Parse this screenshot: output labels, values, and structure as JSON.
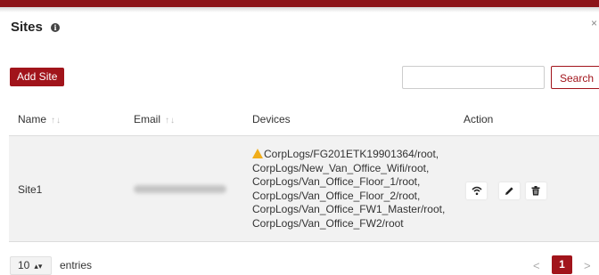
{
  "dialog": {
    "title": "Sites",
    "info_icon": "info-icon",
    "close_icon": "×"
  },
  "toolbar": {
    "add_label": "Add Site",
    "search_value": "",
    "search_placeholder": "",
    "search_label": "Search"
  },
  "table": {
    "columns": {
      "name": "Name",
      "email": "Email",
      "devices": "Devices",
      "action": "Action"
    },
    "sort_glyph": "↑↓",
    "rows": [
      {
        "name": "Site1",
        "email": "",
        "devices": [
          "CorpLogs/FG201ETK19901364/root,",
          "CorpLogs/New_Van_Office_Wifi/root,",
          "CorpLogs/Van_Office_Floor_1/root,",
          "CorpLogs/Van_Office_Floor_2/root,",
          "CorpLogs/Van_Office_FW1_Master/root,",
          "CorpLogs/Van_Office_FW2/root"
        ],
        "first_device_warning": true,
        "actions": [
          "wifi-icon",
          "pencil-icon",
          "trash-icon"
        ]
      }
    ]
  },
  "footer": {
    "page_size": "10",
    "entries_label": "entries",
    "current_page": "1",
    "prev": "<",
    "next": ">"
  },
  "colors": {
    "brand": "#a1141b",
    "topbar": "#8c1419",
    "warning": "#f0ad1a",
    "row_bg": "#f2f2f2"
  }
}
